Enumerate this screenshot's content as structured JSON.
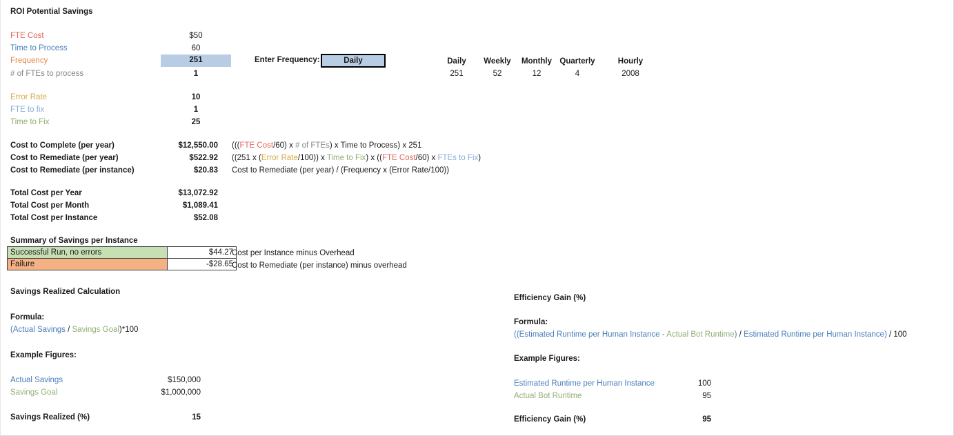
{
  "title": "ROI Potential Savings",
  "inputs": [
    {
      "label": "FTE Cost",
      "value": "$50",
      "color": "#e0645c"
    },
    {
      "label": "Time to Process",
      "value": "60",
      "color": "#4a7ebb"
    },
    {
      "label": "Frequency",
      "value": "251",
      "color": "#e08a4a"
    },
    {
      "label": "# of FTEs to process",
      "value": "1",
      "color": "#858585"
    }
  ],
  "error_inputs": [
    {
      "label": "Error Rate",
      "value": "10",
      "color": "#d6a94a"
    },
    {
      "label": "FTE to fix",
      "value": "1",
      "color": "#86abd9"
    },
    {
      "label": "Time to Fix",
      "value": "25",
      "color": "#8faf72"
    }
  ],
  "frequency_selector": {
    "label": "Enter Frequency:",
    "value": "Daily",
    "options": [
      "Daily",
      "Weekly",
      "Monthly",
      "Quarterly",
      "Hourly"
    ]
  },
  "frequency_table": {
    "headers": [
      "Daily",
      "Weekly",
      "Monthly",
      "Quarterly",
      "Hourly"
    ],
    "values": [
      "251",
      "52",
      "12",
      "4",
      "2008"
    ]
  },
  "costs": [
    {
      "label": "Cost to Complete (per year)",
      "value": "$12,550.00",
      "formula": [
        {
          "t": "(((",
          "c": "black"
        },
        {
          "t": "FTE Cost",
          "c": "red"
        },
        {
          "t": "/60) x ",
          "c": "black"
        },
        {
          "t": "# of FTEs",
          "c": "gray"
        },
        {
          "t": ") x ",
          "c": "black"
        },
        {
          "t": "Time to Process",
          "c": "black"
        },
        {
          "t": ") x 251",
          "c": "black"
        }
      ]
    },
    {
      "label": "Cost to Remediate (per year)",
      "value": "$522.92",
      "formula": [
        {
          "t": "((251 x (",
          "c": "black"
        },
        {
          "t": "Error Rate",
          "c": "gold"
        },
        {
          "t": "/100)) x ",
          "c": "black"
        },
        {
          "t": "Time to Fix",
          "c": "green"
        },
        {
          "t": ") x ((",
          "c": "black"
        },
        {
          "t": "FTE Cost",
          "c": "red"
        },
        {
          "t": "/60) x ",
          "c": "black"
        },
        {
          "t": "FTEs to Fix",
          "c": "ltblue"
        },
        {
          "t": ")",
          "c": "black"
        }
      ]
    },
    {
      "label": "Cost to Remediate (per instance)",
      "value": "$20.83",
      "formula": [
        {
          "t": "Cost to Remediate (per year) / (Frequency x (Error Rate/100))",
          "c": "black"
        }
      ]
    }
  ],
  "totals": [
    {
      "label": "Total Cost per Year",
      "value": "$13,072.92"
    },
    {
      "label": "Total Cost per Month",
      "value": "$1,089.41"
    },
    {
      "label": "Total Cost per Instance",
      "value": "$52.08"
    }
  ],
  "summary": {
    "heading": "Summary of Savings per Instance",
    "rows": [
      {
        "label": "Successful Run, no errors",
        "value": "$44.27",
        "note": "Cost per Instance minus Overhead"
      },
      {
        "label": "Failure",
        "value": "-$28.65",
        "note": "Cost to Remediate (per instance) minus overhead"
      }
    ]
  },
  "savings_section": {
    "heading": "Savings Realized Calculation",
    "formula_heading": "Formula:",
    "formula": [
      {
        "t": "(",
        "c": "blue"
      },
      {
        "t": "Actual Savings",
        "c": "blue"
      },
      {
        "t": " / ",
        "c": "black"
      },
      {
        "t": "Savings Goal",
        "c": "green"
      },
      {
        "t": ")*100",
        "c": "black"
      }
    ],
    "examples_heading": "Example Figures:",
    "examples": [
      {
        "label": "Actual Savings",
        "value": "$150,000",
        "color": "#4a7ebb"
      },
      {
        "label": "Savings Goal",
        "value": "$1,000,000",
        "color": "#8faf72"
      }
    ],
    "result": {
      "label": "Savings Realized (%)",
      "value": "15"
    }
  },
  "efficiency_section": {
    "heading": "Efficiency Gain (%)",
    "formula_heading": "Formula:",
    "formula": [
      {
        "t": "((Estimated Runtime per Human Instance - ",
        "c": "blue"
      },
      {
        "t": "Actual Bot Runtime",
        "c": "green"
      },
      {
        "t": ")",
        "c": "blue"
      },
      {
        "t": " / ",
        "c": "black"
      },
      {
        "t": "Estimated Runtime per Human Instance",
        "c": "blue"
      },
      {
        "t": ")",
        "c": "blue"
      },
      {
        "t": " / 100",
        "c": "black"
      }
    ],
    "examples_heading": "Example Figures:",
    "examples": [
      {
        "label": "Estimated Runtime per Human Instance",
        "value": "100",
        "color": "#4a7ebb"
      },
      {
        "label": "Actual Bot Runtime",
        "value": "95",
        "color": "#8faf72"
      }
    ],
    "result": {
      "label": "Efficiency Gain (%)",
      "value": "95"
    }
  }
}
